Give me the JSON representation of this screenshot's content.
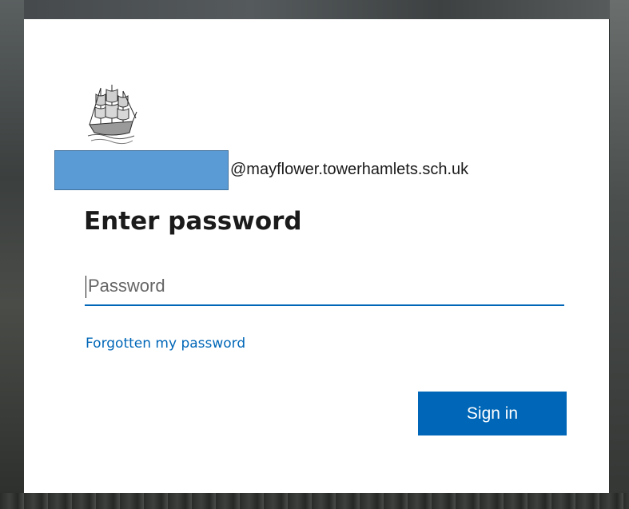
{
  "login": {
    "logo_icon": "sailing-ship-logo",
    "email_suffix": "@mayflower.towerhamlets.sch.uk",
    "redacted_color": "#5b9bd5",
    "title": "Enter password",
    "password_placeholder": "Password",
    "password_value": "",
    "forgot_link": "Forgotten my password",
    "signin_label": "Sign in",
    "accent_color": "#0067b8"
  }
}
